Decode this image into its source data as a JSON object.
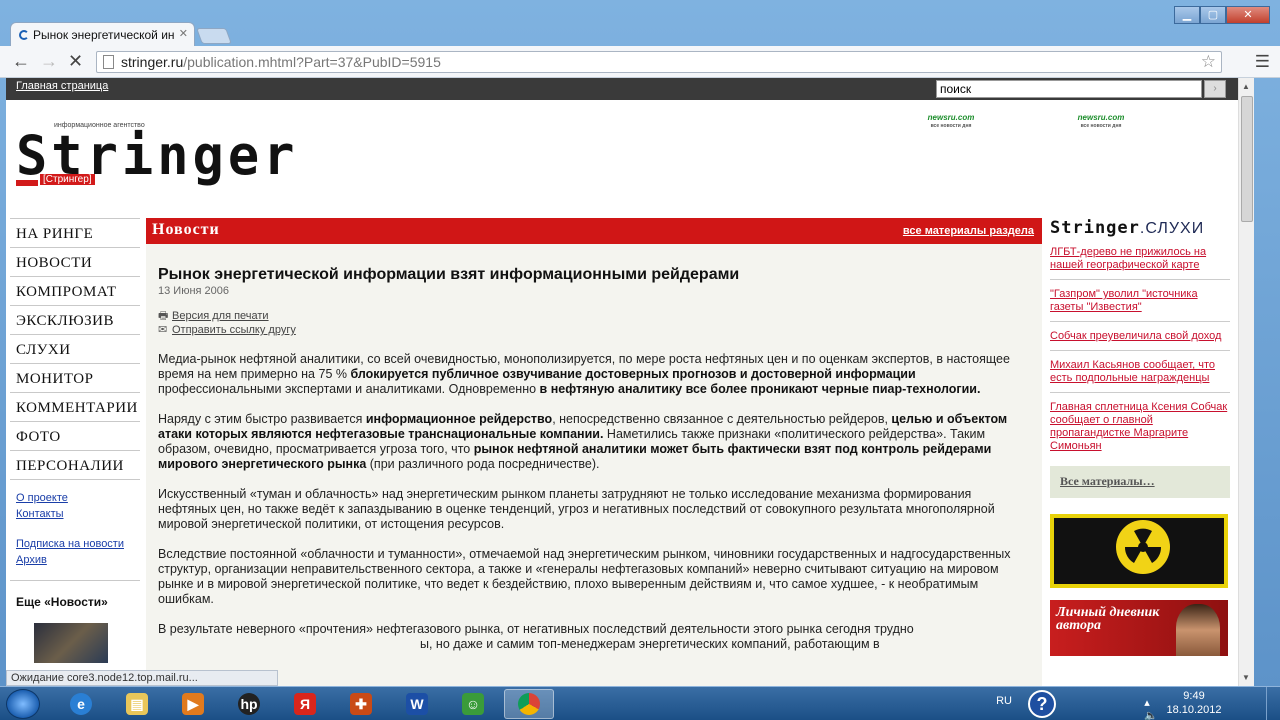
{
  "browser": {
    "tab_title": "Рынок энергетической ин",
    "url_host": "stringer.ru",
    "url_path": "/publication.mhtml?Part=37&PubID=5915",
    "status": "Ожидание core3.node12.top.mail.ru..."
  },
  "site": {
    "home_link": "Главная страница",
    "search_value": "поиск",
    "logo_small": "информационное агентство",
    "logo_text": "Stringer",
    "logo_tag": "[Стрингер]",
    "newsru": [
      {
        "brand": "newsru.com",
        "sub": "все новости дня"
      },
      {
        "brand": "newsru.com",
        "sub": "все новости дня"
      }
    ]
  },
  "nav": {
    "items": [
      "НА РИНГЕ",
      "НОВОСТИ",
      "КОМПРОМАТ",
      "ЭКСКЛЮЗИВ",
      "СЛУХИ",
      "МОНИТОР",
      "КОММЕНТАРИИ",
      "ФОТО",
      "ПЕРСОНАЛИИ"
    ],
    "links": [
      "О проекте",
      "Контакты",
      "Подписка на новости",
      "Архив"
    ],
    "more_title": "Еще «Новости»"
  },
  "section": {
    "title": "Новости",
    "all_link": "все материалы раздела"
  },
  "article": {
    "title": "Рынок энергетической информации взят информационными рейдерами",
    "date": "13 Июня 2006",
    "print": "Версия для печати",
    "send": "Отправить ссылку другу",
    "p1": [
      "Медиа-рынок нефтяной аналитики, со всей очевидностью, монополизируется, по мере роста нефтяных цен и по оценкам экспертов, в настоящее время на нем примерно на 75 % ",
      "блокируется публичное озвучивание достоверных прогнозов и достоверной информации",
      " профессиональными экспертами и аналитиками. Одновременно ",
      "в нефтяную аналитику все более проникают черные пиар-технологии."
    ],
    "p2": [
      "Наряду с этим быстро развивается ",
      "информационное рейдерство",
      ", непосредственно связанное с деятельностью рейдеров, ",
      "целью и объектом атаки которых являются нефтегазовые транснациональные компании.",
      " Наметились также признаки «политического рейдерства». Таким образом, очевидно, просматривается угроза того, что ",
      "рынок нефтяной аналитики может быть фактически взят под контроль рейдерами мирового энергетического рынка",
      " (при различного рода посредничестве)."
    ],
    "p3": "Искусственный «туман и облачность» над энергетическим рынком планеты затрудняют не только исследование механизма формирования нефтяных цен, но также ведёт к запаздыванию в оценке тенденций, угроз и негативных последствий от совокупного результата многополярной мировой энергетической политики, от истощения ресурсов.",
    "p4": "Вследствие постоянной «облачности и туманности», отмечаемой над энергетическим рынком, чиновники государственных и надгосударственных структур, организации неправительственного сектора, а также и «генералы нефтегазовых компаний» неверно считывают ситуацию на мировом рынке и в мировой энергетической политике, что ведет к бездействию, плохо выверенным действиям и, что самое худшее, - к необратимым ошибкам.",
    "p5": "В результате неверного «прочтения» нефтегазового рынка, от негативных последствий деятельности этого рынка сегодня трудно",
    "p6": "ы, но даже и самим топ-менеджерам энергетических компаний, работающим в"
  },
  "rumors": {
    "brand": "Stringer",
    "title": ".СЛУХИ",
    "items": [
      "ЛГБТ-дерево не прижилось на нашей географической карте",
      "\"Газпром\" уволил \"источника газеты \"Известия\"",
      "Собчак преувеличила свой доход",
      "Михаил Касьянов сообщает, что есть подпольные награжденцы",
      "Главная сплетница Ксения Собчак сообщает о главной пропагандистке Маргарите Симоньян"
    ],
    "all": "Все материалы…",
    "diary": "Личный дневник автора"
  },
  "taskbar": {
    "lang": "RU",
    "time": "9:49",
    "date": "18.10.2012"
  },
  "colors": {
    "accent_red": "#d01616",
    "link_red": "#c8102e",
    "taskbar": "#1b4f86"
  }
}
